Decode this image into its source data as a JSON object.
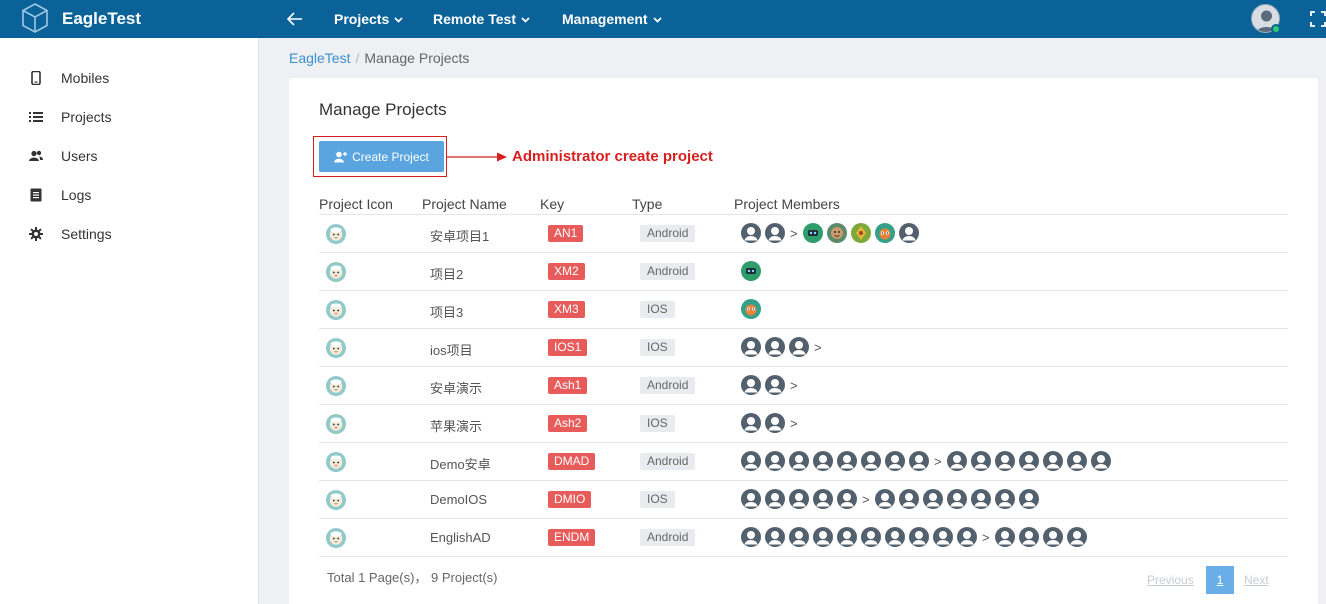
{
  "app": {
    "brand": "EagleTest"
  },
  "topnav": [
    {
      "label": "Projects"
    },
    {
      "label": "Remote Test"
    },
    {
      "label": "Management"
    }
  ],
  "sidebar": {
    "items": [
      {
        "label": "Mobiles",
        "icon": "mobile-icon"
      },
      {
        "label": "Projects",
        "icon": "list-icon"
      },
      {
        "label": "Users",
        "icon": "users-icon"
      },
      {
        "label": "Logs",
        "icon": "document-icon"
      },
      {
        "label": "Settings",
        "icon": "gear-icon"
      }
    ]
  },
  "breadcrumb": {
    "root": "EagleTest",
    "sep": "/",
    "current": "Manage Projects"
  },
  "page": {
    "title": "Manage Projects",
    "create_label": "Create Project"
  },
  "annotation": {
    "text": "Administrator create project",
    "color": "#d81f1f"
  },
  "table": {
    "headers": [
      "Project Icon",
      "Project Name",
      "Key",
      "Type",
      "Project Members"
    ],
    "rows": [
      {
        "name": "安卓项目1",
        "key": "AN1",
        "type": "Android",
        "members": [
          "p",
          "p",
          ">",
          "c1",
          "c2",
          "c3",
          "c4",
          "p"
        ]
      },
      {
        "name": "项目2",
        "key": "XM2",
        "type": "Android",
        "members": [
          "c1"
        ]
      },
      {
        "name": "项目3",
        "key": "XM3",
        "type": "IOS",
        "members": [
          "c4"
        ]
      },
      {
        "name": "ios项目",
        "key": "IOS1",
        "type": "IOS",
        "members": [
          "p",
          "p",
          "p",
          ">"
        ]
      },
      {
        "name": "安卓演示",
        "key": "Ash1",
        "type": "Android",
        "members": [
          "p",
          "p",
          ">"
        ]
      },
      {
        "name": "苹果演示",
        "key": "Ash2",
        "type": "IOS",
        "members": [
          "p",
          "p",
          ">"
        ]
      },
      {
        "name": "Demo安卓",
        "key": "DMAD",
        "type": "Android",
        "members": [
          "p",
          "p",
          "p",
          "p",
          "p",
          "p",
          "p",
          "p",
          ">",
          "p",
          "p",
          "p",
          "p",
          "p",
          "p",
          "p"
        ]
      },
      {
        "name": "DemoIOS",
        "key": "DMIO",
        "type": "IOS",
        "members": [
          "p",
          "p",
          "p",
          "p",
          "p",
          ">",
          "p",
          "p",
          "p",
          "p",
          "p",
          "p",
          "p"
        ]
      },
      {
        "name": "EnglishAD",
        "key": "ENDM",
        "type": "Android",
        "members": [
          "p",
          "p",
          "p",
          "p",
          "p",
          "p",
          "p",
          "p",
          "p",
          "p",
          ">",
          "p",
          "p",
          "p",
          "p"
        ]
      }
    ]
  },
  "footer": {
    "total": "Total 1 Page(s)， 9 Project(s)"
  },
  "pagination": {
    "prev": "Previous",
    "current": "1",
    "next": "Next"
  },
  "colors": {
    "topbar": "#0a6299",
    "accent": "#5aa5e0",
    "key_badge": "#e85b5b"
  }
}
